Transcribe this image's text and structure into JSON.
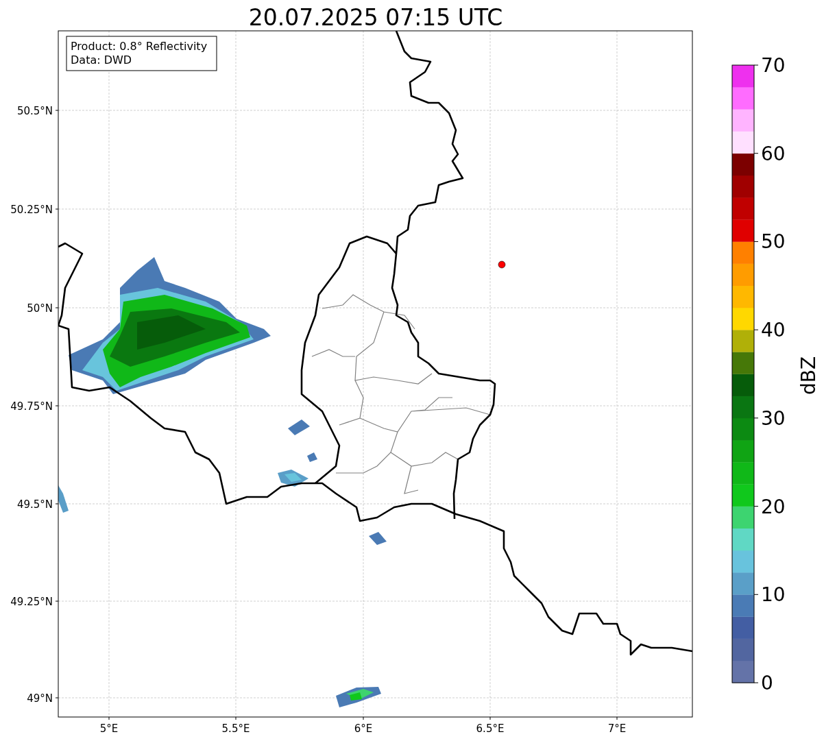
{
  "title": "20.07.2025 07:15 UTC",
  "info_box": [
    "Product: 0.8° Reflectivity",
    "Data: DWD"
  ],
  "y_ticks": [
    "50.5°N",
    "50.25°N",
    "50°N",
    "49.75°N",
    "49.5°N",
    "49.25°N",
    "49°N"
  ],
  "x_ticks": [
    "5°E",
    "5.5°E",
    "6°E",
    "6.5°E",
    "7°E"
  ],
  "colorbar": {
    "label": "dBZ",
    "ticks": [
      "70",
      "60",
      "50",
      "40",
      "30",
      "20",
      "10",
      "0"
    ],
    "segments": [
      {
        "color": "#6473a8"
      },
      {
        "color": "#5266a0"
      },
      {
        "color": "#435ea3"
      },
      {
        "color": "#4a7bb5"
      },
      {
        "color": "#5a9fc8"
      },
      {
        "color": "#68c3dd"
      },
      {
        "color": "#60d8c4"
      },
      {
        "color": "#3dd470"
      },
      {
        "color": "#10c81c"
      },
      {
        "color": "#10b818"
      },
      {
        "color": "#10a414"
      },
      {
        "color": "#0c8a12"
      },
      {
        "color": "#0a7612"
      },
      {
        "color": "#065c0a"
      },
      {
        "color": "#467808"
      },
      {
        "color": "#b0b008"
      },
      {
        "color": "#ffd800"
      },
      {
        "color": "#ffb800"
      },
      {
        "color": "#ff9c00"
      },
      {
        "color": "#ff8000"
      },
      {
        "color": "#e00000"
      },
      {
        "color": "#c00000"
      },
      {
        "color": "#a00000"
      },
      {
        "color": "#7c0000"
      },
      {
        "color": "#ffe0ff"
      },
      {
        "color": "#ffb4ff"
      },
      {
        "color": "#ff6cff"
      },
      {
        "color": "#ee30ee"
      }
    ]
  }
}
